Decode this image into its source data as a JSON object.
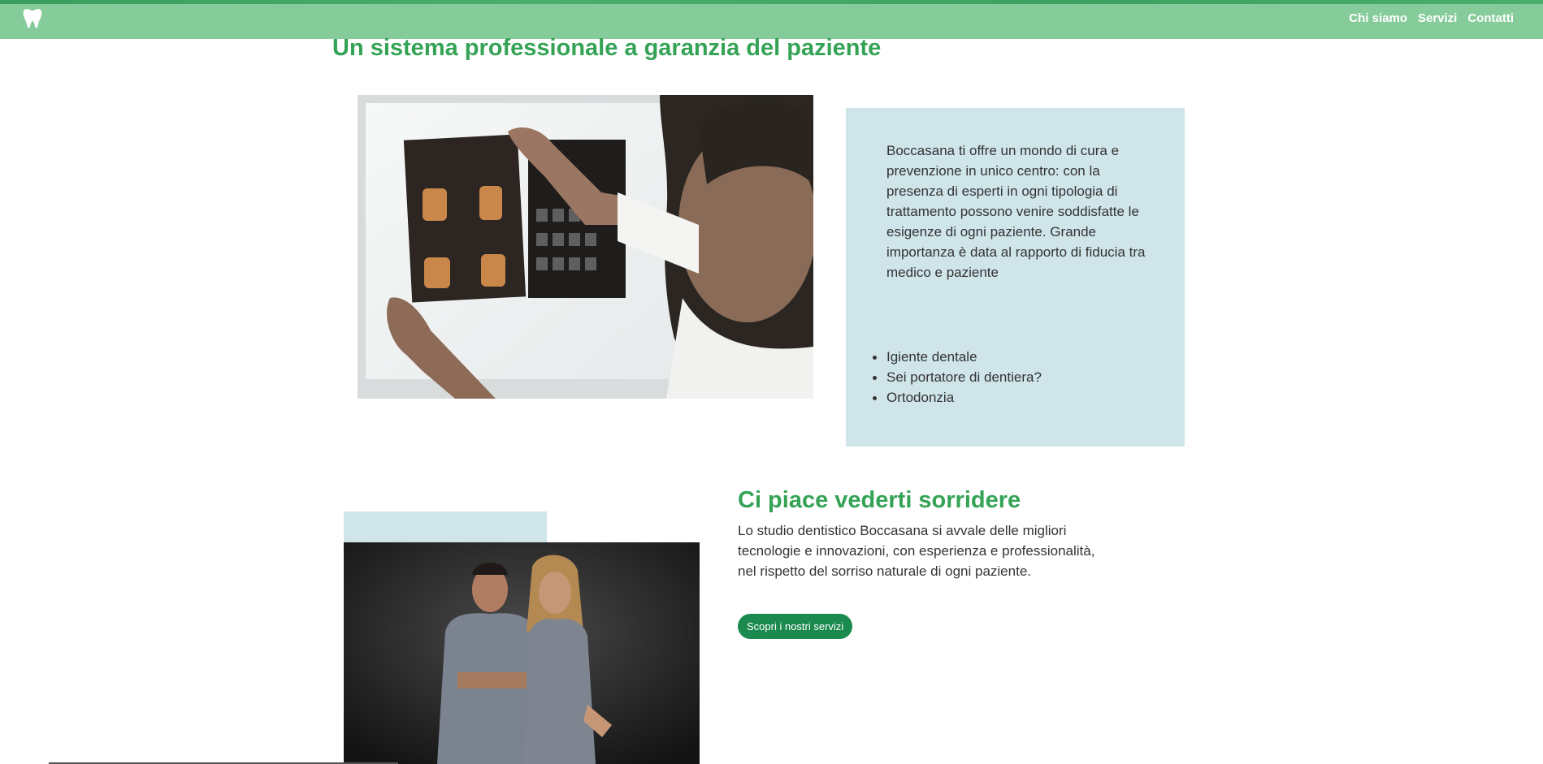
{
  "nav": {
    "logo_icon": "tooth-icon",
    "links": [
      {
        "label": "Chi siamo"
      },
      {
        "label": "Servizi"
      },
      {
        "label": "Contatti"
      }
    ]
  },
  "section_one": {
    "title": "Un sistema professionale a garanzia del paziente",
    "image": "dentist-examining-xray-photo",
    "info_text": "Boccasana ti offre un mondo di cura e prevenzione in unico centro: con la presenza di esperti in ogni tipologia di trattamento possono venire soddisfatte le esigenze di ogni paziente. Grande importanza è data al rapporto di fiducia tra medico e paziente",
    "services": [
      "Igiente dentale",
      "Sei portatore di dentiera?",
      "Ortodonzia"
    ]
  },
  "section_two": {
    "title": "Ci piace vederti sorridere",
    "image": "dental-team-photo",
    "text": "Lo studio dentistico Boccasana si avvale delle migliori tecnologie e innovazioni, con esperienza e professionalità, nel rispetto del sorriso naturale di ogni paziente.",
    "button_label": "Scopri i nostri servizi"
  },
  "colors": {
    "navbar": "#86cc9b",
    "heading_green": "#35a356",
    "info_box": "#cfe5ea",
    "button": "#1b8a4f"
  }
}
